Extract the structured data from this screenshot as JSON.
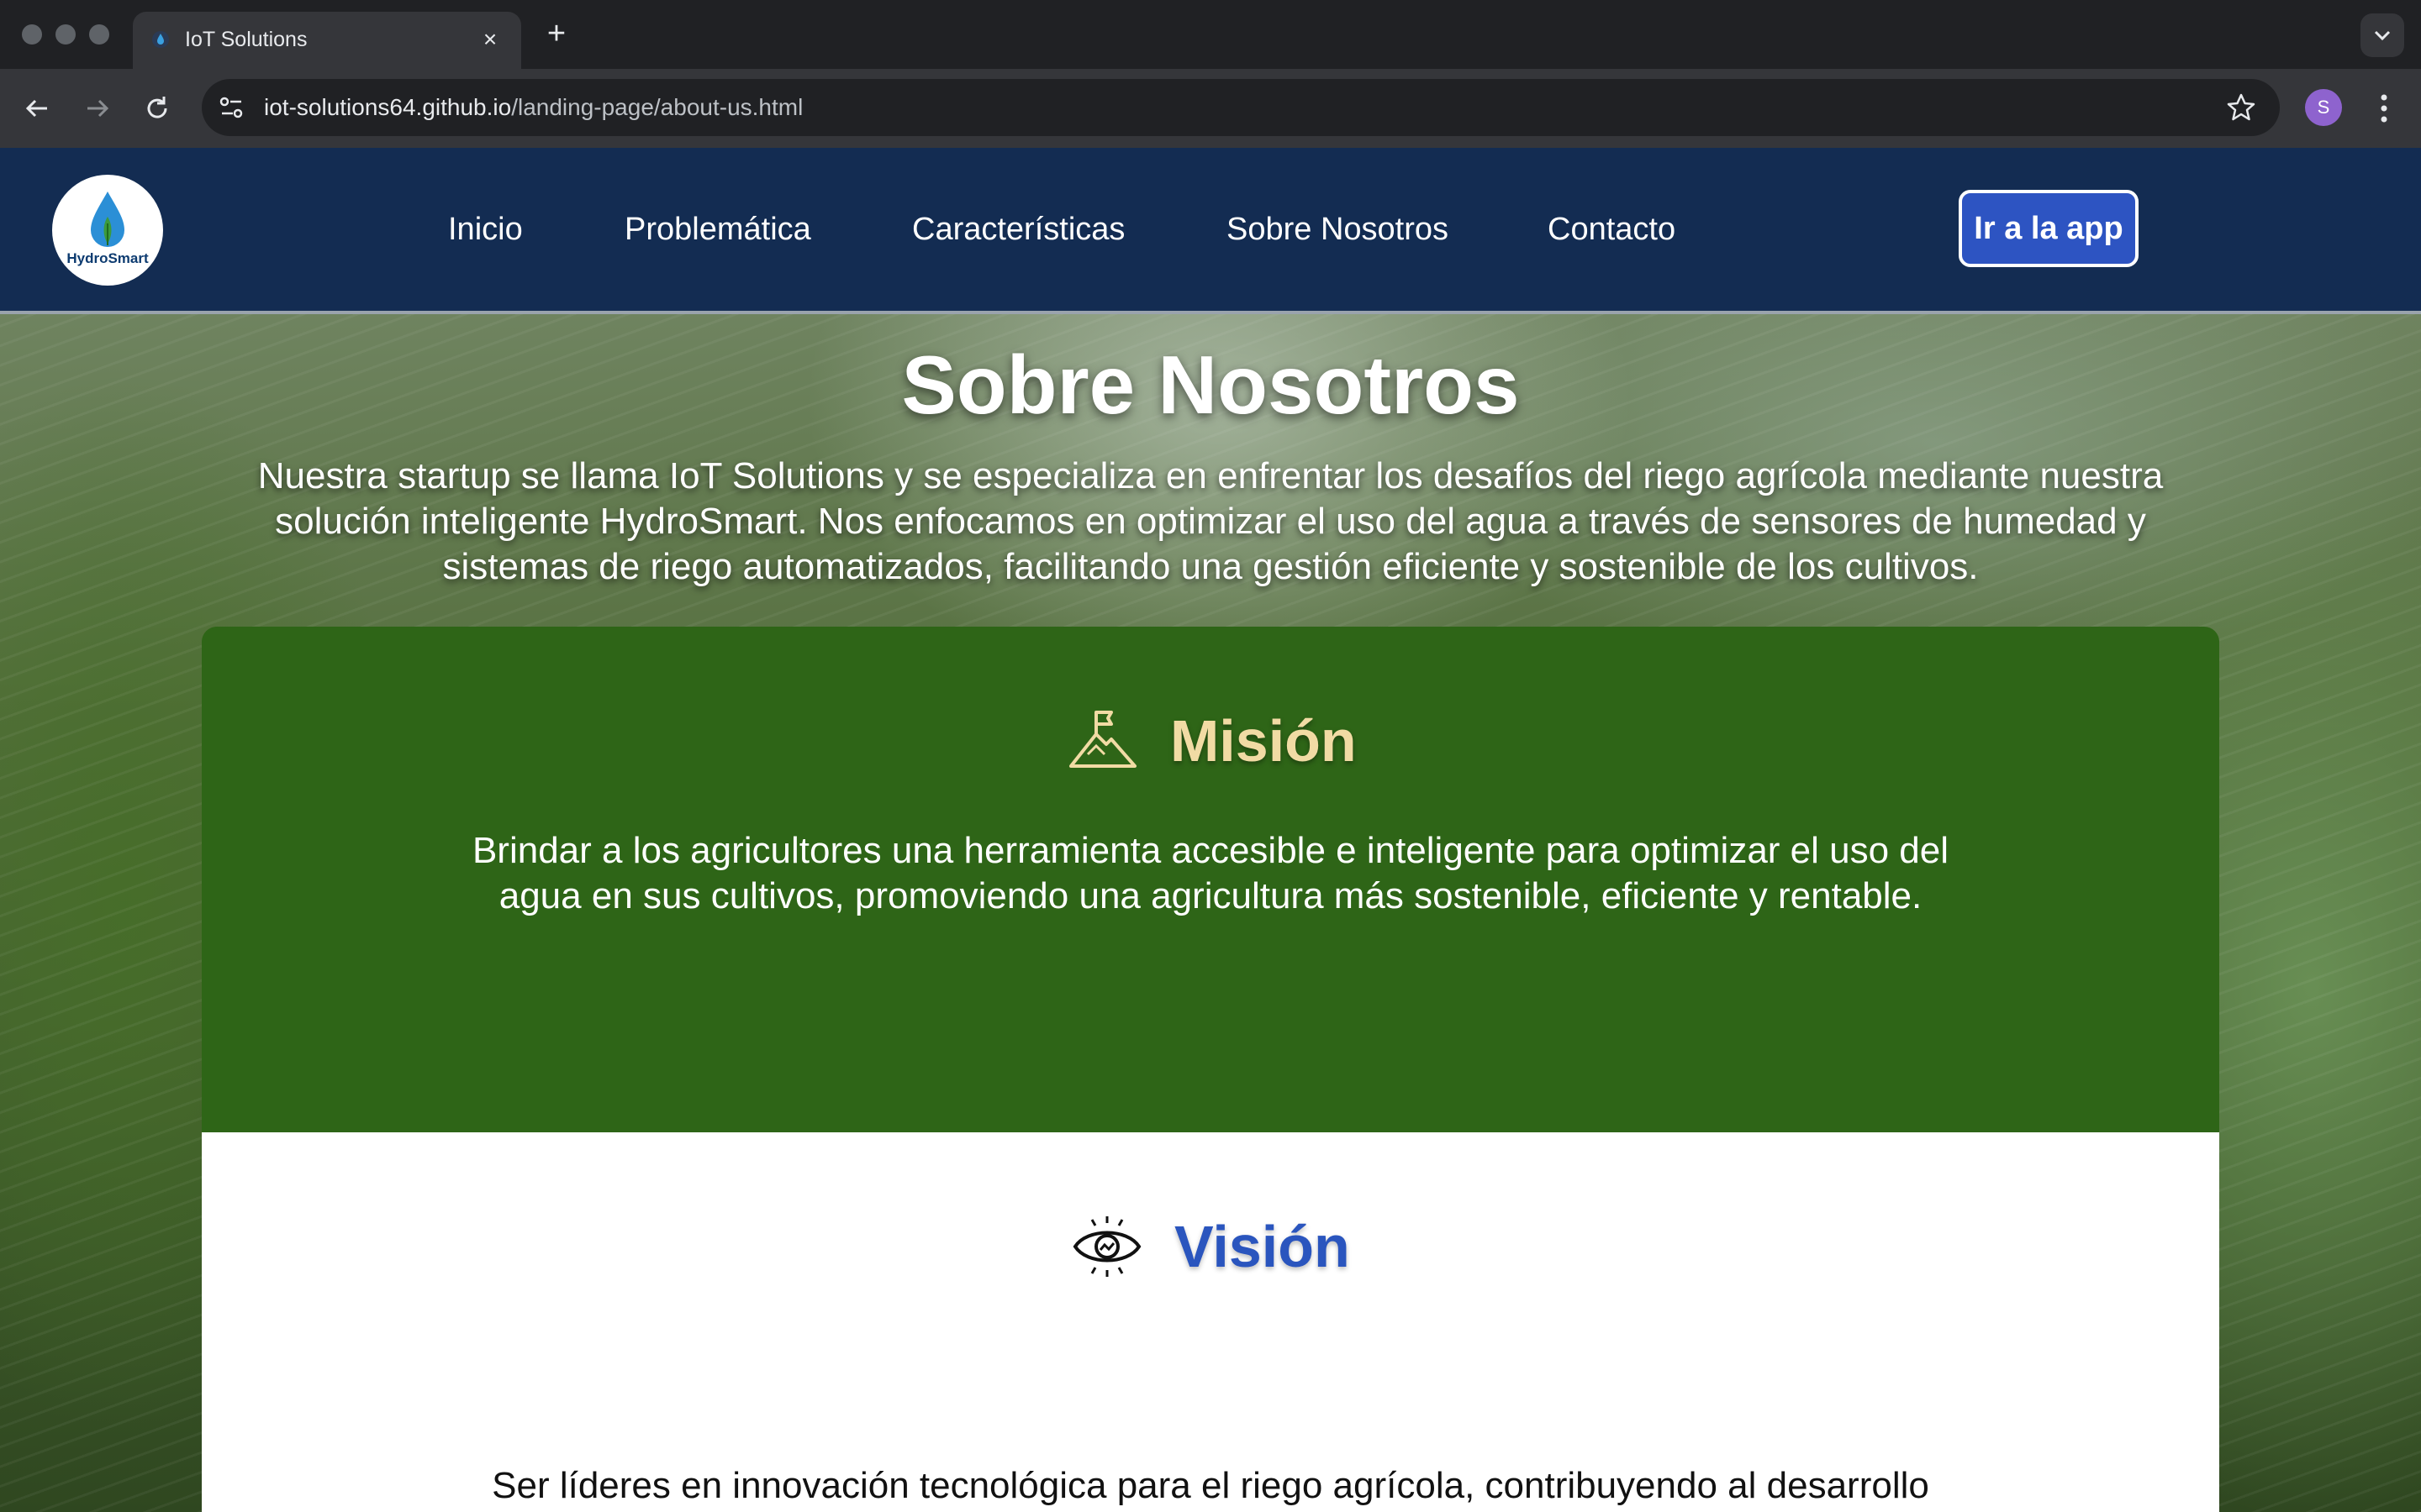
{
  "browser": {
    "tab_title": "IoT Solutions",
    "url_host": "iot-solutions64.github.io",
    "url_path": "/landing-page/about-us.html",
    "profile_initial": "S"
  },
  "navbar": {
    "logo_text": "HydroSmart",
    "links": [
      "Inicio",
      "Problemática",
      "Características",
      "Sobre Nosotros",
      "Contacto"
    ],
    "cta_label": "Ir a la app"
  },
  "hero": {
    "title": "Sobre Nosotros",
    "description": "Nuestra startup se llama IoT Solutions y se especializa en enfrentar los desafíos del riego agrícola mediante nuestra solución inteligente HydroSmart. Nos enfocamos en optimizar el uso del agua a través de sensores de humedad y sistemas de riego automatizados, facilitando una gestión eficiente y sostenible de los cultivos."
  },
  "mission": {
    "title": "Misión",
    "icon": "mountain-flag-icon",
    "text": "Brindar a los agricultores una herramienta accesible e inteligente para optimizar el uso del agua en sus cultivos, promoviendo una agricultura más sostenible, eficiente y rentable."
  },
  "vision": {
    "title": "Visión",
    "icon": "eye-icon",
    "text": "Ser líderes en innovación tecnológica para el riego agrícola, contribuyendo al desarrollo sostenible de la agricultura mediante soluciones basadas en IoT."
  },
  "colors": {
    "navbar_bg": "#132c52",
    "cta_bg": "#2d54c2",
    "mission_bg": "#2e6517",
    "mission_title": "#f1dba4",
    "vision_title": "#2a55be"
  }
}
